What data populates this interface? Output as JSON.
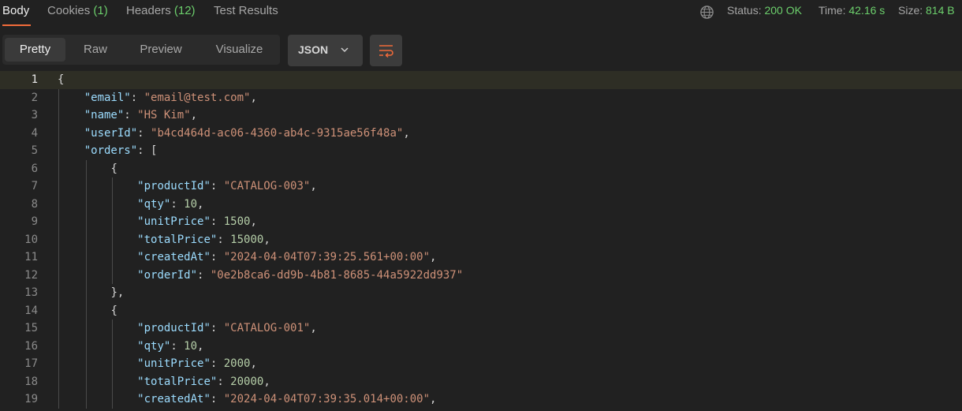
{
  "tabs": {
    "body": "Body",
    "cookies": "Cookies",
    "cookies_count": "(1)",
    "headers": "Headers",
    "headers_count": "(12)",
    "test_results": "Test Results"
  },
  "status": {
    "status_label": "Status:",
    "status_value": "200 OK",
    "time_label": "Time:",
    "time_value": "42.16 s",
    "size_label": "Size:",
    "size_value": "814 B"
  },
  "view_modes": [
    "Pretty",
    "Raw",
    "Preview",
    "Visualize"
  ],
  "format": {
    "label": "JSON"
  },
  "icons": [
    "globe-icon",
    "chevron-down-icon",
    "wrap-lines-icon"
  ],
  "colors": {
    "accent": "#f26b3a",
    "success": "#6ccf6c",
    "json_key": "#9cdcfe",
    "json_string": "#ce9178",
    "json_number": "#b5cea8"
  },
  "code_lines": [
    {
      "n": "1",
      "indent": "",
      "key": "",
      "sep": "",
      "value": "",
      "vtype": "p",
      "tail": "{"
    },
    {
      "n": "2",
      "indent": "    ",
      "key": "\"email\"",
      "sep": ": ",
      "value": "\"email@test.com\"",
      "vtype": "s",
      "tail": ","
    },
    {
      "n": "3",
      "indent": "    ",
      "key": "\"name\"",
      "sep": ": ",
      "value": "\"HS Kim\"",
      "vtype": "s",
      "tail": ","
    },
    {
      "n": "4",
      "indent": "    ",
      "key": "\"userId\"",
      "sep": ": ",
      "value": "\"b4cd464d-ac06-4360-ab4c-9315ae56f48a\"",
      "vtype": "s",
      "tail": ","
    },
    {
      "n": "5",
      "indent": "    ",
      "key": "\"orders\"",
      "sep": ": ",
      "value": "",
      "vtype": "p",
      "tail": "["
    },
    {
      "n": "6",
      "indent": "        ",
      "key": "",
      "sep": "",
      "value": "",
      "vtype": "p",
      "tail": "{"
    },
    {
      "n": "7",
      "indent": "            ",
      "key": "\"productId\"",
      "sep": ": ",
      "value": "\"CATALOG-003\"",
      "vtype": "s",
      "tail": ","
    },
    {
      "n": "8",
      "indent": "            ",
      "key": "\"qty\"",
      "sep": ": ",
      "value": "10",
      "vtype": "n",
      "tail": ","
    },
    {
      "n": "9",
      "indent": "            ",
      "key": "\"unitPrice\"",
      "sep": ": ",
      "value": "1500",
      "vtype": "n",
      "tail": ","
    },
    {
      "n": "10",
      "indent": "            ",
      "key": "\"totalPrice\"",
      "sep": ": ",
      "value": "15000",
      "vtype": "n",
      "tail": ","
    },
    {
      "n": "11",
      "indent": "            ",
      "key": "\"createdAt\"",
      "sep": ": ",
      "value": "\"2024-04-04T07:39:25.561+00:00\"",
      "vtype": "s",
      "tail": ","
    },
    {
      "n": "12",
      "indent": "            ",
      "key": "\"orderId\"",
      "sep": ": ",
      "value": "\"0e2b8ca6-dd9b-4b81-8685-44a5922dd937\"",
      "vtype": "s",
      "tail": ""
    },
    {
      "n": "13",
      "indent": "        ",
      "key": "",
      "sep": "",
      "value": "",
      "vtype": "p",
      "tail": "},"
    },
    {
      "n": "14",
      "indent": "        ",
      "key": "",
      "sep": "",
      "value": "",
      "vtype": "p",
      "tail": "{"
    },
    {
      "n": "15",
      "indent": "            ",
      "key": "\"productId\"",
      "sep": ": ",
      "value": "\"CATALOG-001\"",
      "vtype": "s",
      "tail": ","
    },
    {
      "n": "16",
      "indent": "            ",
      "key": "\"qty\"",
      "sep": ": ",
      "value": "10",
      "vtype": "n",
      "tail": ","
    },
    {
      "n": "17",
      "indent": "            ",
      "key": "\"unitPrice\"",
      "sep": ": ",
      "value": "2000",
      "vtype": "n",
      "tail": ","
    },
    {
      "n": "18",
      "indent": "            ",
      "key": "\"totalPrice\"",
      "sep": ": ",
      "value": "20000",
      "vtype": "n",
      "tail": ","
    },
    {
      "n": "19",
      "indent": "            ",
      "key": "\"createdAt\"",
      "sep": ": ",
      "value": "\"2024-04-04T07:39:35.014+00:00\"",
      "vtype": "s",
      "tail": ","
    }
  ]
}
